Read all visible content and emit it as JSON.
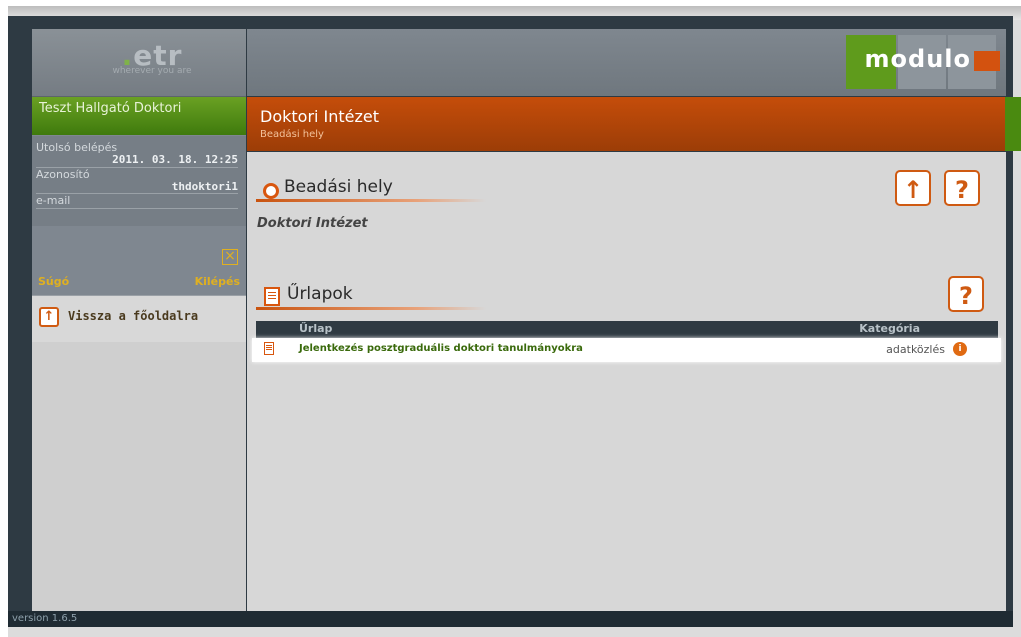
{
  "brand": {
    "logo_text": "etr",
    "logo_tagline": "wherever you are",
    "product_logo": "modulo",
    "accent_green": "#4a8a10",
    "accent_orange": "#cf5a12"
  },
  "sidebar": {
    "user_name": "Teszt Hallgató Doktori",
    "last_login_label": "Utolsó belépés",
    "last_login_value": "2011. 03. 18. 12:25",
    "id_label": "Azonosító",
    "id_value": "thdoktori1",
    "email_label": "e-mail",
    "help_label": "Súgó",
    "logout_label": "Kilépés",
    "back_label": "Vissza a főoldalra"
  },
  "header": {
    "title": "Doktori Intézet",
    "subtitle": "Beadási hely"
  },
  "main": {
    "section1_title": "Beadási hely",
    "section1_body": "Doktori Intézet",
    "section2_title": "Űrlapok",
    "table": {
      "columns": [
        "Űrlap",
        "Kategória"
      ],
      "rows": [
        {
          "form": "Jelentkezés posztgraduális doktori tanulmányokra",
          "category": "adatközlés"
        }
      ]
    }
  },
  "footer": {
    "version": "version 1.6.5"
  }
}
